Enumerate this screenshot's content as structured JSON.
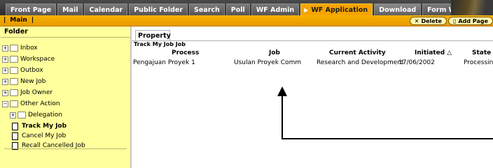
{
  "top_tabs": [
    {
      "label": "Front Page"
    },
    {
      "label": "Mail"
    },
    {
      "label": "Calendar"
    },
    {
      "label": "Public Folder"
    },
    {
      "label": "Search"
    },
    {
      "label": "Poll"
    },
    {
      "label": "WF Admin"
    },
    {
      "label": "WF Application"
    },
    {
      "label": "Download"
    },
    {
      "label": "Form Wizard"
    }
  ],
  "orange_bar": {
    "main_label": "Main",
    "delete_label": "Delete",
    "add_page_label": "Add Page"
  },
  "sidebar": {
    "heading": "Folder",
    "items": [
      {
        "label": "Inbox"
      },
      {
        "label": "Workspace"
      },
      {
        "label": "Outbox"
      },
      {
        "label": "New Job"
      },
      {
        "label": "Job Owner"
      },
      {
        "label": "Other Action"
      },
      {
        "label": "Delegation"
      },
      {
        "label": "Track My Job"
      },
      {
        "label": "Cancel My Job"
      },
      {
        "label": "Recall Cancelled Job"
      }
    ]
  },
  "content": {
    "tab_label": "Property",
    "table_title": "Track My Job Job",
    "columns": [
      "Process",
      "Job",
      "Current Activity",
      "Initiated",
      "State"
    ],
    "sort_indicator": "△",
    "rows": [
      {
        "process": "Pengajuan Proyek 1",
        "job": "Usulan Proyek Comm",
        "activity": "Research and Development",
        "initiated": "17/06/2002",
        "state": "Processing"
      }
    ]
  },
  "colors": {
    "accent": "#f5a400",
    "sidebar_bg": "#ffff9c",
    "topbar": "#3a3a3a"
  }
}
